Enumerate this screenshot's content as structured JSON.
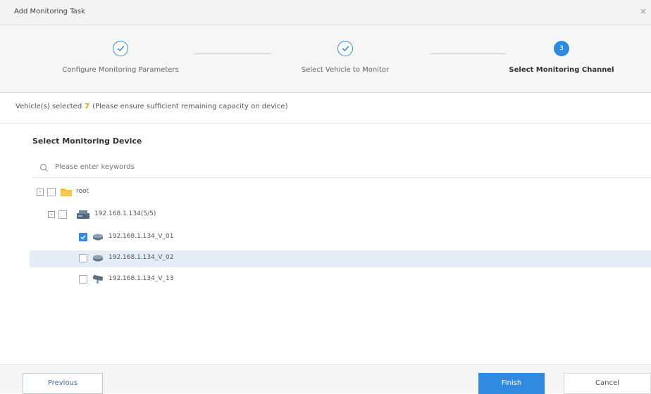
{
  "dialog": {
    "title": "Add Monitoring Task",
    "close_glyph": "×"
  },
  "steps": [
    {
      "label": "Configure Monitoring Parameters",
      "state": "done"
    },
    {
      "label": "Select Vehicle to Monitor",
      "state": "done"
    },
    {
      "label": "Select Monitoring Channel",
      "state": "current",
      "number": "3"
    }
  ],
  "info": {
    "prefix": "Vehicle(s) selected",
    "count": "7",
    "note": "(Please ensure sufficient remaining capacity on device)"
  },
  "section": {
    "title": "Select Monitoring Device"
  },
  "search": {
    "placeholder": "Please enter keywords",
    "value": ""
  },
  "tree": {
    "root": {
      "label": "root",
      "expander": "-",
      "icon": "folder-icon"
    },
    "device": {
      "label": "192.168.1.134(5/5)",
      "expander": "-",
      "icon": "nvr-device-icon"
    },
    "channels": [
      {
        "label": "192.168.1.134_V_01",
        "checked": true,
        "icon": "dome-camera-icon"
      },
      {
        "label": "192.168.1.134_V_02",
        "checked": false,
        "icon": "dome-camera-icon",
        "selected": true
      },
      {
        "label": "192.168.1.134_V_13",
        "checked": false,
        "icon": "bullet-camera-icon"
      }
    ]
  },
  "footer": {
    "previous_label": "Previous",
    "finish_label": "Finish",
    "cancel_label": "Cancel"
  },
  "colors": {
    "accent": "#2f8ae0",
    "warning": "#f29b00",
    "row_selected": "#e4ecf5"
  }
}
